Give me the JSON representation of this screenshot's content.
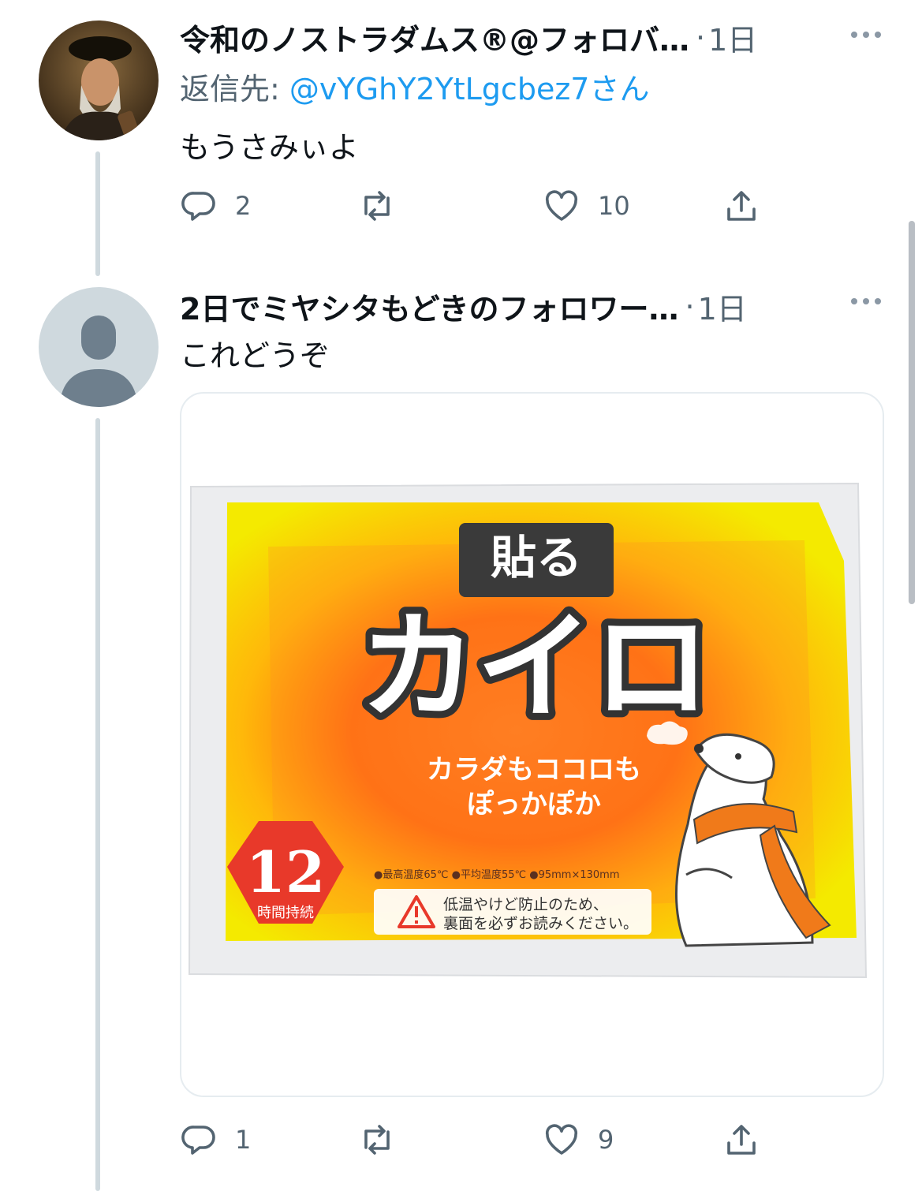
{
  "tweets": [
    {
      "display_name": "令和のノストラダムス®@フォロバ…",
      "separator": "·",
      "time": "1日",
      "reply_label": "返信先:",
      "reply_handle": "@vYGhY2YtLgcbez7",
      "reply_suffix": "さん",
      "text": "もうさみぃよ",
      "reply_count": "2",
      "retweet_count": "",
      "like_count": "10"
    },
    {
      "display_name": "2日でミヤシタもどきのフォロワー…",
      "separator": "·",
      "time": "1日",
      "text": "これどうぞ",
      "reply_count": "1",
      "retweet_count": "",
      "like_count": "9",
      "media": {
        "badge": "貼る",
        "title": "カイロ",
        "tagline_1": "カラダもココロも",
        "tagline_2": "ぽっかぽか",
        "hours": "12",
        "hours_label": "時間持続",
        "specs": "●最高温度65℃ ●平均温度55℃ ●95mm×130mm",
        "warning_1": "低温やけど防止のため、",
        "warning_2": "裏面を必ずお読みください。"
      }
    }
  ],
  "colors": {
    "link": "#1d9bf0",
    "secondary_text": "#536471",
    "thread_line": "#cfd9de"
  },
  "icons": [
    "reply-icon",
    "retweet-icon",
    "like-icon",
    "share-icon",
    "more-icon"
  ]
}
